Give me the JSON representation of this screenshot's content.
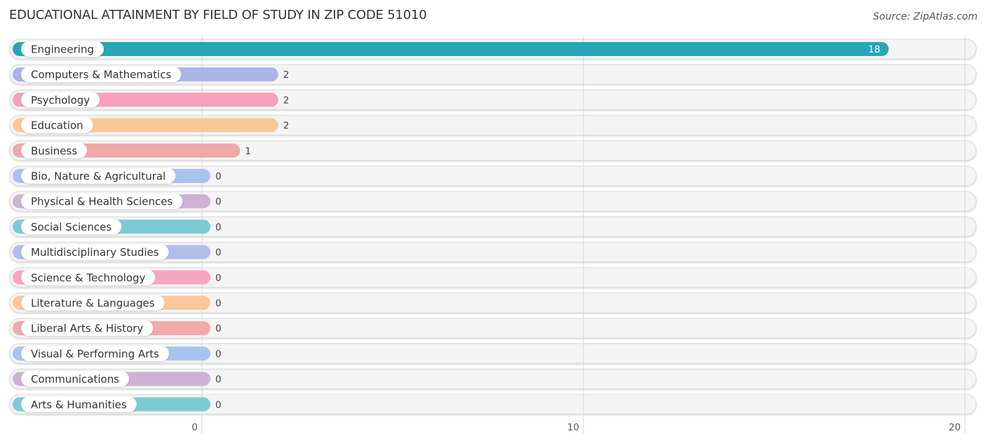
{
  "header": {
    "title": "EDUCATIONAL ATTAINMENT BY FIELD OF STUDY IN ZIP CODE 51010",
    "source": "Source: ZipAtlas.com"
  },
  "chart_data": {
    "type": "bar",
    "orientation": "horizontal",
    "title": "EDUCATIONAL ATTAINMENT BY FIELD OF STUDY IN ZIP CODE 51010",
    "source": "Source: ZipAtlas.com",
    "xlabel": "",
    "ylabel": "",
    "xlim": [
      0,
      20
    ],
    "xticks": [
      0,
      10,
      20
    ],
    "xtick_labels": [
      "0",
      "10",
      "20"
    ],
    "grid": true,
    "legend": "none",
    "categories": [
      "Engineering",
      "Computers & Mathematics",
      "Psychology",
      "Education",
      "Business",
      "Bio, Nature & Agricultural",
      "Physical & Health Sciences",
      "Social Sciences",
      "Multidisciplinary Studies",
      "Science & Technology",
      "Literature & Languages",
      "Liberal Arts & History",
      "Visual & Performing Arts",
      "Communications",
      "Arts & Humanities"
    ],
    "values": [
      18,
      2,
      2,
      2,
      1,
      0,
      0,
      0,
      0,
      0,
      0,
      0,
      0,
      0,
      0
    ],
    "value_labels": [
      "18",
      "2",
      "2",
      "2",
      "1",
      "0",
      "0",
      "0",
      "0",
      "0",
      "0",
      "0",
      "0",
      "0",
      "0"
    ],
    "colors": [
      "#2aa5b5",
      "#aab4e6",
      "#f5a0bc",
      "#f9c898",
      "#f0a8a8",
      "#a8c4ec",
      "#cdb2d6",
      "#7ecad2",
      "#b4bce8",
      "#f7a6c0",
      "#f9c89e",
      "#f0aaaa",
      "#a8c4ec",
      "#cdb2d6",
      "#7ecad2"
    ]
  }
}
